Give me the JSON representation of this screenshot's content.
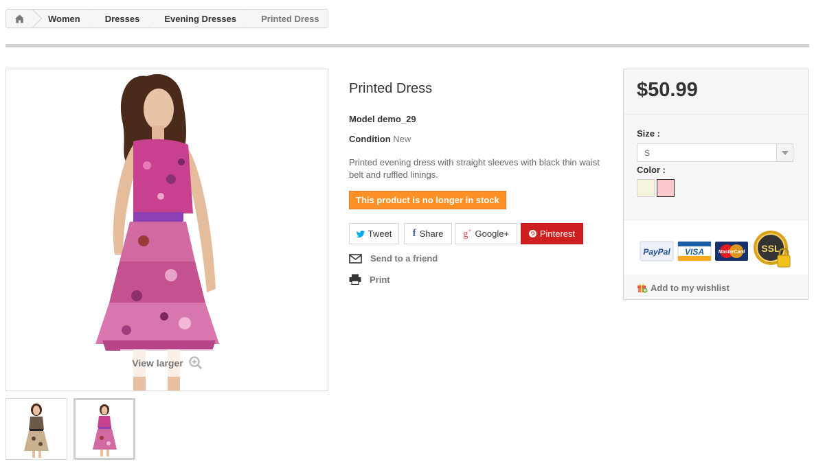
{
  "breadcrumb": {
    "home_icon": "home-icon",
    "items": [
      "Women",
      "Dresses",
      "Evening Dresses"
    ],
    "current": "Printed Dress"
  },
  "gallery": {
    "view_larger": "View larger",
    "zoom_icon": "magnifier-plus-icon"
  },
  "product": {
    "title": "Printed Dress",
    "model_label": "Model",
    "model_value": "demo_29",
    "condition_label": "Condition",
    "condition_value": "New",
    "description": "Printed evening dress with straight sleeves with black thin waist belt and ruffled linings.",
    "stock_notice": "This product is no longer in stock"
  },
  "social": {
    "tweet": "Tweet",
    "share": "Share",
    "googleplus": "Google+",
    "pinterest": "Pinterest"
  },
  "actions": {
    "send_to_friend": "Send to a friend",
    "print": "Print"
  },
  "buybox": {
    "price": "$50.99",
    "size_label": "Size :",
    "size_value": "S",
    "color_label": "Color :",
    "colors": [
      "#f5f5dc",
      "#fcc8cc"
    ],
    "wishlist": "Add to my wishlist",
    "payment_logos": [
      "PayPal",
      "VISA",
      "MasterCard",
      "SSL"
    ]
  },
  "colors": {
    "stock_badge": "#fe9126",
    "pinterest": "#ce1f21",
    "twitter_blue": "#00aaf0",
    "googleplus_red": "#e54a4f"
  }
}
